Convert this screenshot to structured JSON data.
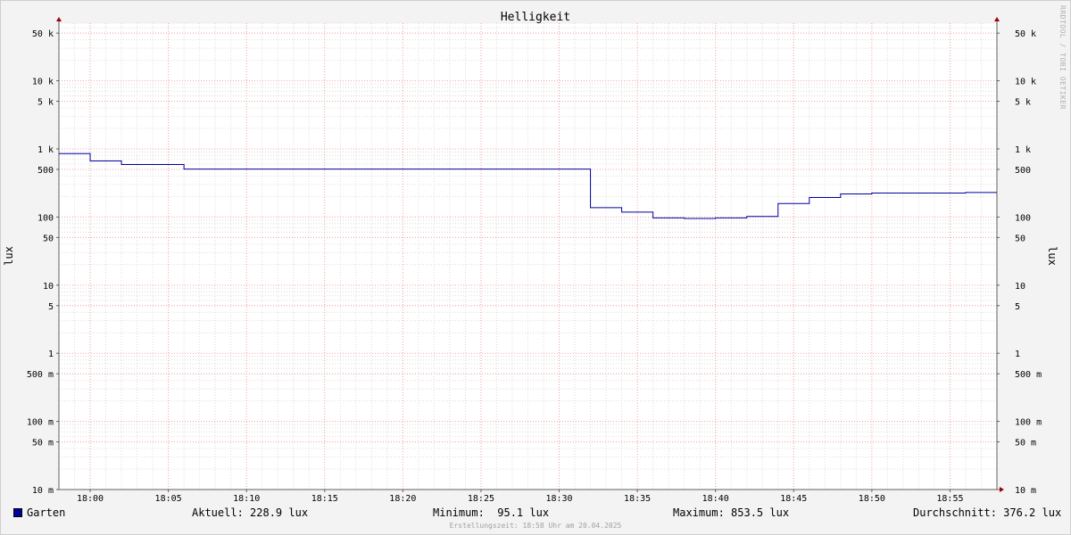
{
  "chart_data": {
    "type": "line",
    "title": "Helligkeit",
    "ylabel": "lux",
    "y_scale": "log",
    "ylim": [
      0.01,
      70000
    ],
    "xlim": [
      "17:58",
      "18:58"
    ],
    "x_ticks": [
      "18:00",
      "18:05",
      "18:10",
      "18:15",
      "18:20",
      "18:25",
      "18:30",
      "18:35",
      "18:40",
      "18:45",
      "18:50",
      "18:55"
    ],
    "y_ticks": [
      {
        "value": 50000,
        "label": "50 k"
      },
      {
        "value": 10000,
        "label": "10 k"
      },
      {
        "value": 5000,
        "label": "5 k"
      },
      {
        "value": 1000,
        "label": "1 k"
      },
      {
        "value": 500,
        "label": "500"
      },
      {
        "value": 100,
        "label": "100"
      },
      {
        "value": 50,
        "label": "50"
      },
      {
        "value": 10,
        "label": "10"
      },
      {
        "value": 5,
        "label": "5"
      },
      {
        "value": 1,
        "label": "1"
      },
      {
        "value": 0.5,
        "label": "500 m"
      },
      {
        "value": 0.1,
        "label": "100 m"
      },
      {
        "value": 0.05,
        "label": "50 m"
      },
      {
        "value": 0.01,
        "label": "10 m"
      }
    ],
    "grid": true,
    "series": [
      {
        "name": "Garten",
        "color": "#0000a0",
        "step": true,
        "x": [
          "17:58",
          "18:00",
          "18:02",
          "18:06",
          "18:32",
          "18:34",
          "18:36",
          "18:38",
          "18:40",
          "18:42",
          "18:44",
          "18:46",
          "18:48",
          "18:50",
          "18:56",
          "18:58"
        ],
        "values": [
          853.5,
          665,
          590,
          505,
          137,
          118,
          97,
          95.1,
          97,
          102,
          158,
          193,
          218,
          225,
          228.9,
          228.9
        ]
      }
    ]
  },
  "legend": {
    "series_name": "Garten",
    "current": "Aktuell: 228.9 lux",
    "minimum": "Minimum:  95.1 lux",
    "maximum": "Maximum: 853.5 lux",
    "average": "Durchschnitt: 376.2 lux"
  },
  "footer": "Erstellungszeit: 18:58 Uhr am 20.04.2025",
  "watermark": "RRDTOOL / TOBI OETIKER"
}
